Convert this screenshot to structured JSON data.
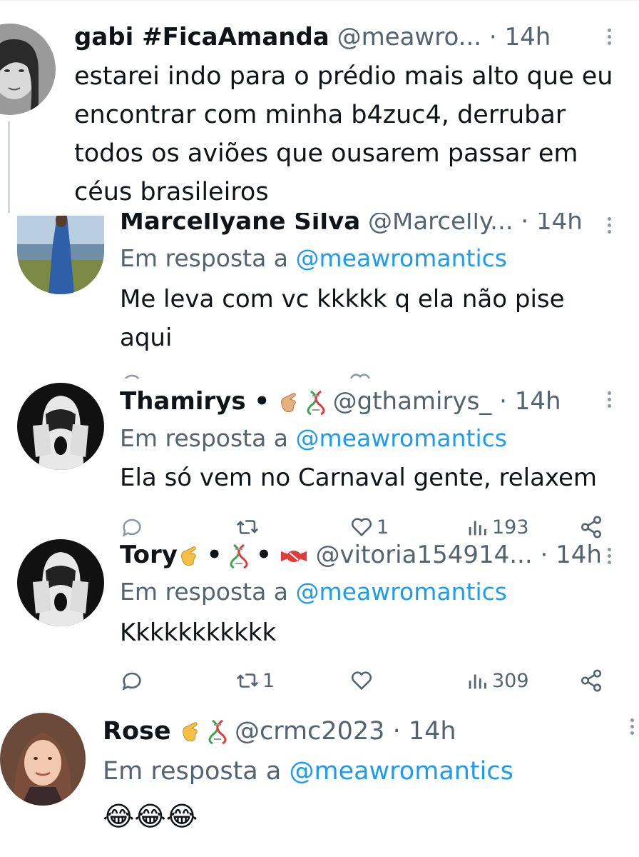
{
  "tweets": [
    {
      "name": "gabi #FicaAmanda",
      "handle": "@meawro...",
      "time": "· 14h",
      "text": "estarei indo para o prédio mais alto que eu encontrar com minha b4zuc4, derrubar todos os aviões que ousarem passar em céus brasileiros"
    },
    {
      "name": "Marcellyane Silva",
      "handle": "@Marcelly...",
      "time": "· 14h",
      "reply_prefix": "Em resposta a",
      "reply_to": "@meawromantics",
      "text": "Me leva com vc kkkkk q ela não pise aqui"
    },
    {
      "name": "Thamirys •",
      "handle": "@gthamirys_",
      "time": "· 14h",
      "reply_prefix": "Em resposta a",
      "reply_to": "@meawromantics",
      "text": "Ela só vem no Carnaval gente, relaxem",
      "likes": "1",
      "views": "193"
    },
    {
      "name": "Tory",
      "name_sep1": "•",
      "name_sep2": "•",
      "handle": "@vitoria154914...",
      "time": "· 14h",
      "reply_prefix": "Em resposta a",
      "reply_to": "@meawromantics",
      "text": "Kkkkkkkkkkk",
      "retweets": "1",
      "views": "309"
    },
    {
      "name": "Rose",
      "handle": "@crmc2023",
      "time": "· 14h",
      "reply_prefix": "Em resposta a",
      "reply_to": "@meawromantics",
      "text": "😂😂😂"
    }
  ],
  "colors": {
    "mention": "#1d9bf0",
    "secondary": "#536471",
    "text": "#0f1419"
  },
  "icons": [
    "reply-icon",
    "retweet-icon",
    "like-icon",
    "views-icon",
    "share-icon",
    "more-icon"
  ]
}
